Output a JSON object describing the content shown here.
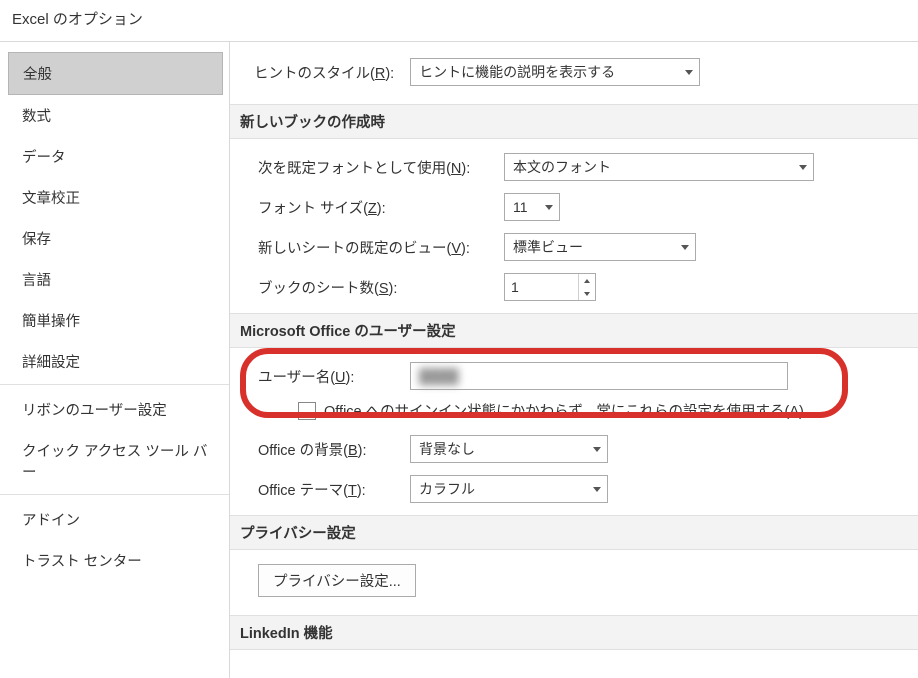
{
  "title": "Excel のオプション",
  "sidebar": {
    "groups": [
      [
        "全般",
        "数式",
        "データ",
        "文章校正",
        "保存",
        "言語",
        "簡単操作",
        "詳細設定"
      ],
      [
        "リボンのユーザー設定",
        "クイック アクセス ツール バー"
      ],
      [
        "アドイン",
        "トラスト センター"
      ]
    ],
    "selected": "全般"
  },
  "hintStyle": {
    "labelPre": "ヒントのスタイル(",
    "hotkey": "R",
    "labelPost": "):",
    "value": "ヒントに機能の説明を表示する"
  },
  "sections": {
    "newBook": "新しいブックの作成時",
    "userSettings": "Microsoft Office のユーザー設定",
    "privacy": "プライバシー設定",
    "linkedin": "LinkedIn 機能"
  },
  "defaultFont": {
    "labelPre": "次を既定フォントとして使用(",
    "hotkey": "N",
    "labelPost": "):",
    "value": "本文のフォント"
  },
  "fontSize": {
    "labelPre": "フォント サイズ(",
    "hotkey": "Z",
    "labelPost": "):",
    "value": "11"
  },
  "defaultView": {
    "labelPre": "新しいシートの既定のビュー(",
    "hotkey": "V",
    "labelPost": "):",
    "value": "標準ビュー"
  },
  "sheetCount": {
    "labelPre": "ブックのシート数(",
    "hotkey": "S",
    "labelPost": "):",
    "value": "1"
  },
  "userName": {
    "labelPre": "ユーザー名(",
    "hotkey": "U",
    "labelPost": "):",
    "value": "████"
  },
  "alwaysUse": {
    "labelPre": "Office へのサインイン状態にかかわらず、常にこれらの設定を使用する(",
    "hotkey": "A",
    "labelPost": ")"
  },
  "background": {
    "labelPre": "Office の背景(",
    "hotkey": "B",
    "labelPost": "):",
    "value": "背景なし"
  },
  "theme": {
    "labelPre": "Office テーマ(",
    "hotkey": "T",
    "labelPost": "):",
    "value": "カラフル"
  },
  "privacyButton": "プライバシー設定..."
}
